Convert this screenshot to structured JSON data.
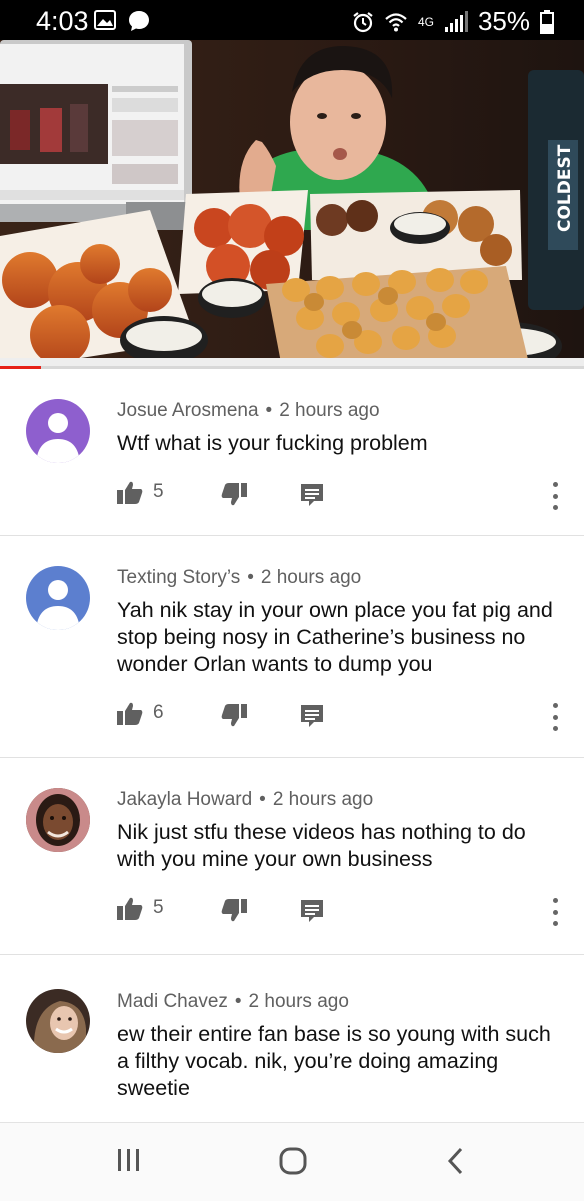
{
  "status_bar": {
    "time": "4:03",
    "network": "4G",
    "battery": "35%"
  },
  "video": {
    "bottle_text": "COLDEST",
    "progress_fraction": 0.07
  },
  "comments": [
    {
      "author": "Josue Arosmena",
      "time": "2 hours ago",
      "text": "Wtf what is your fucking problem",
      "likes": "5",
      "avatar": "default-purple"
    },
    {
      "author": "Texting Story’s",
      "time": "2 hours ago",
      "text": "Yah nik stay in your own place you fat pig and stop being nosy in Catherine’s business no wonder Orlan wants to dump you",
      "likes": "6",
      "avatar": "default-blue"
    },
    {
      "author": "Jakayla Howard",
      "time": "2 hours ago",
      "text": "Nik just stfu these videos has nothing to do with you mine your own business",
      "likes": "5",
      "avatar": "photo"
    },
    {
      "author": "Madi Chavez",
      "time": "2 hours ago",
      "text": "ew their entire fan base is so young with such a filthy vocab. nik, you’re doing amazing sweetie",
      "avatar": "photo"
    }
  ],
  "meta_separator": "•",
  "colors": {
    "progress": "#e62117",
    "avatar_purple": "#8e5fce",
    "avatar_blue": "#5c7fcf"
  }
}
